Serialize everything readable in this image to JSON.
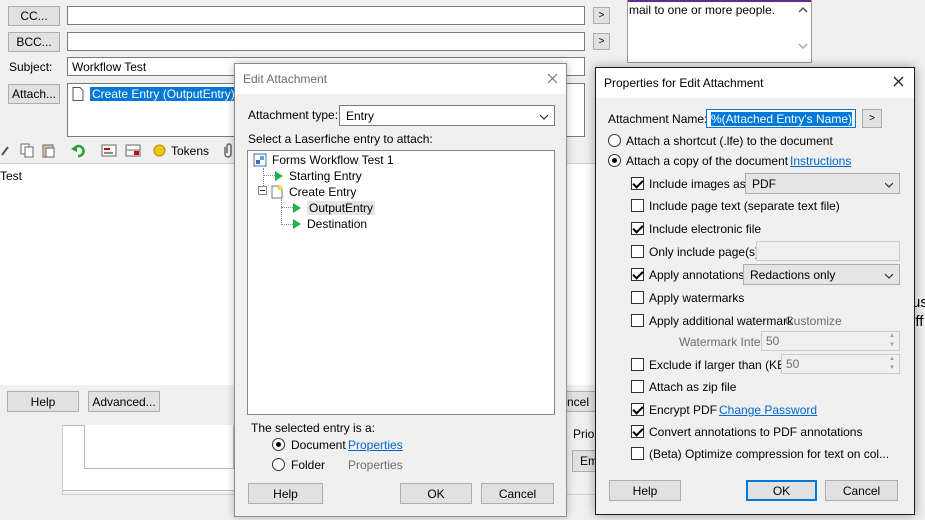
{
  "email": {
    "cc_label": "CC...",
    "bcc_label": "BCC...",
    "subject_label": "Subject:",
    "subject_value": "Workflow Test",
    "attach_label": "Attach...",
    "attachment_item": "Create Entry (OutputEntry)",
    "more_button": ">",
    "toolbar_tokens": "Tokens",
    "body_text": "Test",
    "help_label": "Help",
    "advanced_label": "Advanced..."
  },
  "background": {
    "top_right_text": "mail to one or more people.",
    "cancel_partial": "ncel",
    "prior_partial": "Prior",
    "em_partial": "Em",
    "right_partial_1": "us",
    "right_partial_2": "iff"
  },
  "edit_attachment": {
    "title": "Edit Attachment",
    "type_label": "Attachment type:",
    "type_value": "Entry",
    "select_label": "Select a Laserfiche entry to attach:",
    "tree": [
      {
        "label": "Forms Workflow Test 1"
      },
      {
        "label": "Starting Entry"
      },
      {
        "label": "Create Entry"
      },
      {
        "label": "OutputEntry"
      },
      {
        "label": "Destination"
      }
    ],
    "selected_label": "The selected entry is a:",
    "document_label": "Document",
    "folder_label": "Folder",
    "properties_link": "Properties",
    "properties_disabled": "Properties",
    "help": "Help",
    "ok": "OK",
    "cancel": "Cancel"
  },
  "properties": {
    "title": "Properties for Edit Attachment",
    "name_label": "Attachment Name:",
    "name_value": "%(Attached Entry's Name)",
    "name_button": ">",
    "shortcut_label": "Attach a shortcut (.lfe) to the document",
    "copy_label": "Attach a copy of the document",
    "instructions_link": "Instructions",
    "include_images": "Include images as:",
    "images_format": "PDF",
    "include_page_text": "Include page text (separate text file)",
    "include_electronic": "Include electronic file",
    "only_pages": "Only include page(s):",
    "apply_annotations": "Apply annotations:",
    "annotations_value": "Redactions only",
    "apply_watermarks": "Apply watermarks",
    "apply_additional_watermark": "Apply additional watermark",
    "customize": "Customize",
    "watermark_intensity_label": "Watermark Intensity:",
    "watermark_intensity_value": "50",
    "exclude_larger": "Exclude if larger than (KB):",
    "exclude_value": "50",
    "attach_zip": "Attach as zip file",
    "encrypt_pdf": "Encrypt PDF",
    "change_password": "Change Password",
    "convert_annotations": "Convert annotations to PDF annotations",
    "optimize": "(Beta) Optimize compression for text on col...",
    "help": "Help",
    "ok": "OK",
    "cancel": "Cancel"
  }
}
